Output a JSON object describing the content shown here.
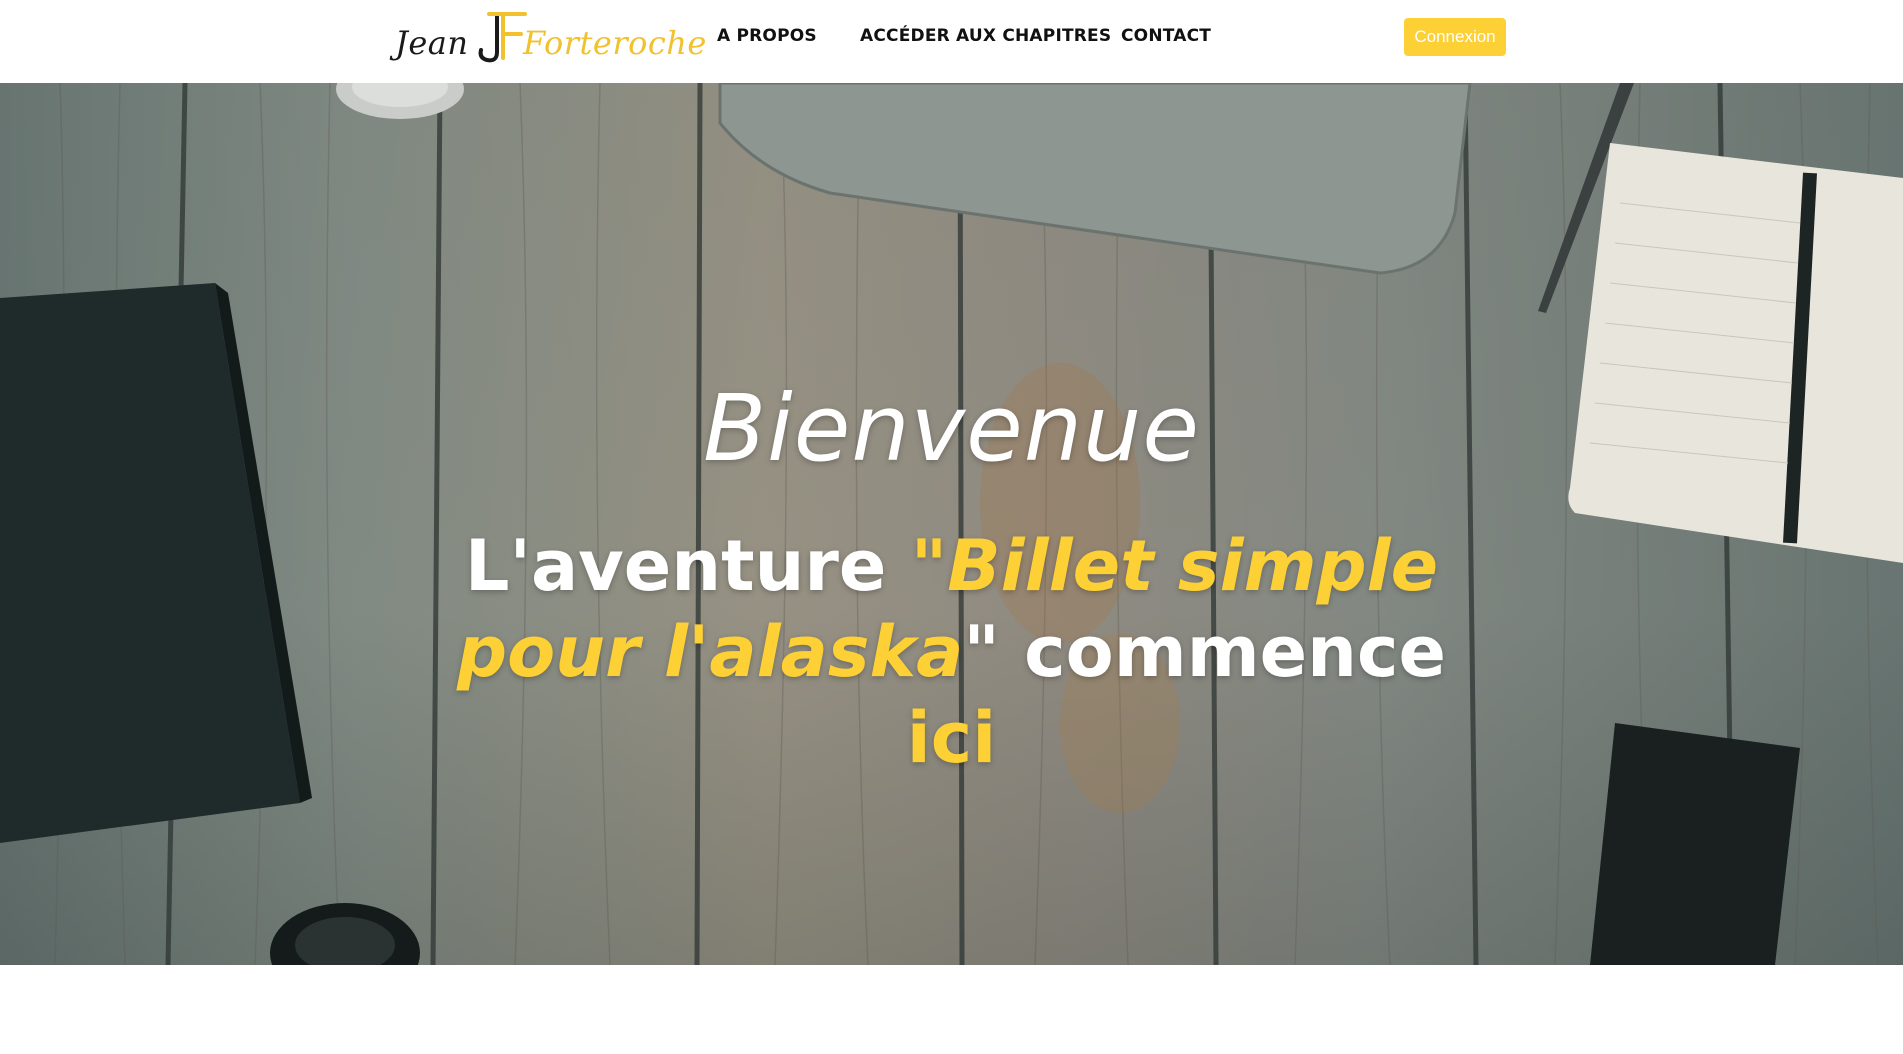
{
  "header": {
    "logo": {
      "first": "Jean",
      "last": "Forteroche"
    },
    "nav": [
      {
        "label": "A PROPOS"
      },
      {
        "label": "ACCÉDER AUX CHAPITRES"
      },
      {
        "label": "CONTACT"
      }
    ],
    "login_label": "Connexion"
  },
  "hero": {
    "welcome": "Bienvenue",
    "tagline": {
      "part1": "L'aventure ",
      "quote_open": "\"",
      "title": "Billet simple pour l'alaska",
      "quote_close": "\"",
      "part2": " commence ",
      "part3": "ici"
    }
  },
  "colors": {
    "accent": "#fdd035",
    "logo_accent": "#f2c12e",
    "text_dark": "#111111"
  }
}
